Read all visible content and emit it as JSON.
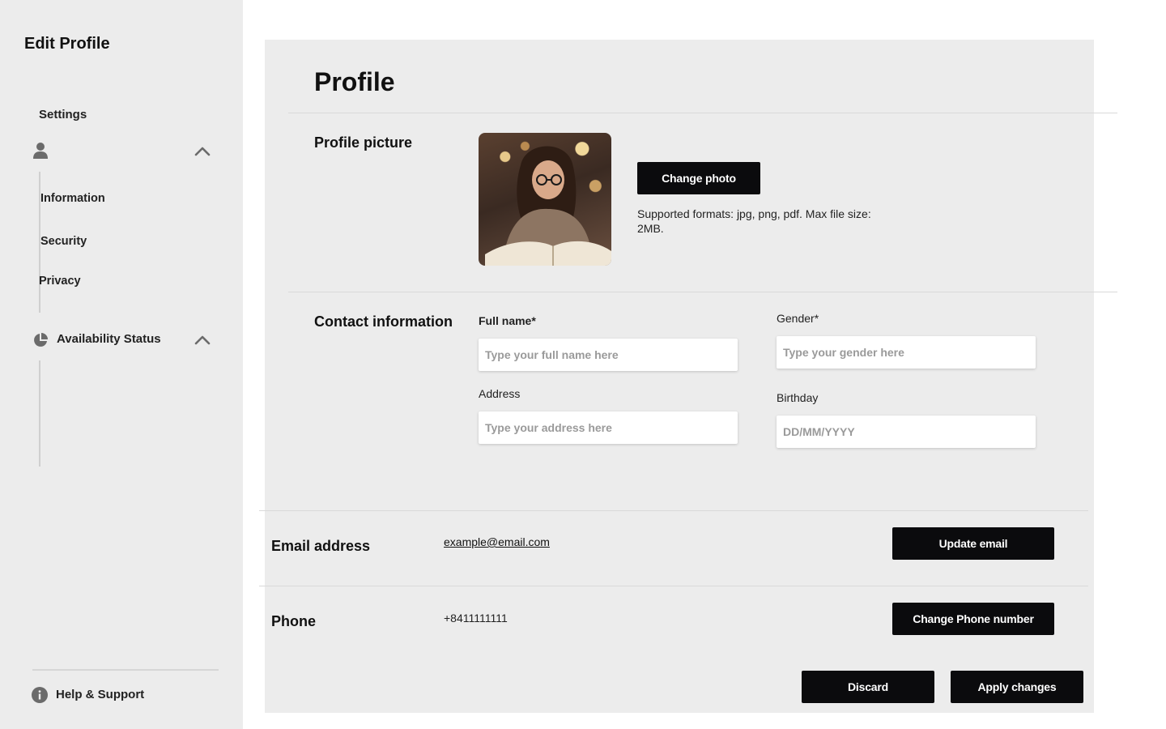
{
  "sidebar": {
    "title": "Edit Profile",
    "settings_label": "Settings",
    "profile_group": {
      "items": [
        {
          "label": "Information"
        },
        {
          "label": "Security"
        },
        {
          "label": "Privacy"
        }
      ]
    },
    "availability_label": "Availability Status",
    "help_label": "Help & Support"
  },
  "main": {
    "title": "Profile",
    "profile_picture": {
      "section_title": "Profile picture",
      "change_button": "Change photo",
      "formats_text": "Supported formats: jpg, png, pdf. Max file size: 2MB."
    },
    "contact": {
      "section_title": "Contact information",
      "full_name_label": "Full name*",
      "full_name_placeholder": "Type your full name here",
      "gender_label": "Gender*",
      "gender_placeholder": "Type your gender here",
      "address_label": "Address",
      "address_placeholder": "Type your address here",
      "birthday_label": "Birthday",
      "birthday_placeholder": "DD/MM/YYYY"
    },
    "email": {
      "label": "Email address",
      "value": "example@email.com",
      "button": "Update email"
    },
    "phone": {
      "label": "Phone",
      "value": "+8411111111",
      "button": "Change Phone number"
    },
    "actions": {
      "discard": "Discard",
      "apply": "Apply changes"
    }
  },
  "colors": {
    "panel_bg": "#ececec",
    "button_bg": "#0b0b0d",
    "button_text": "#ffffff"
  }
}
